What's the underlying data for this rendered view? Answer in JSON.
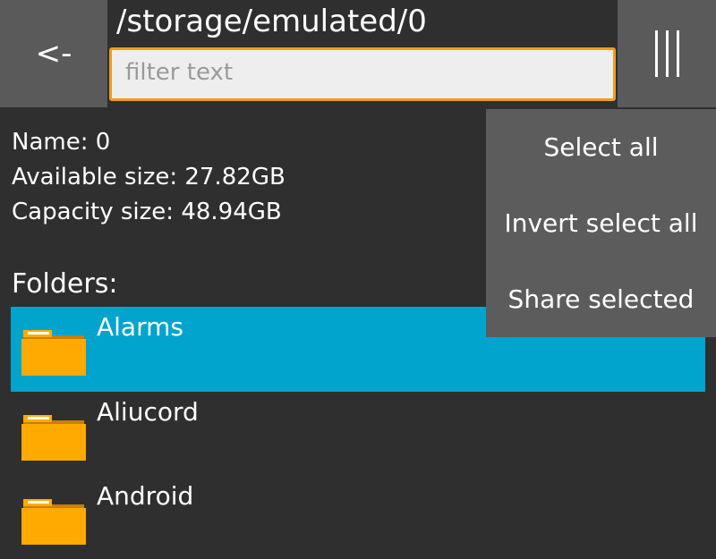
{
  "header": {
    "back_label": "<-",
    "path": "/storage/emulated/0",
    "filter_placeholder": "filter text",
    "filter_value": ""
  },
  "storage_info": {
    "name": "Name: 0",
    "available": "Available size: 27.82GB",
    "capacity": "Capacity size: 48.94GB"
  },
  "folders": {
    "heading": "Folders:",
    "items": [
      {
        "label": "Alarms",
        "selected": true
      },
      {
        "label": "Aliucord",
        "selected": false
      },
      {
        "label": "Android",
        "selected": false
      }
    ]
  },
  "menu": {
    "icon": "menu-bars-icon",
    "items": [
      {
        "label": "Select all"
      },
      {
        "label": "Invert select all"
      },
      {
        "label": "Share selected"
      }
    ]
  },
  "colors": {
    "background": "#2f2f2f",
    "header_button": "#5a5a5a",
    "filter_border": "#f39b1c",
    "selected_row": "#00a4cc",
    "menu_background": "#5c5c5c",
    "folder": "#ffaa00"
  }
}
